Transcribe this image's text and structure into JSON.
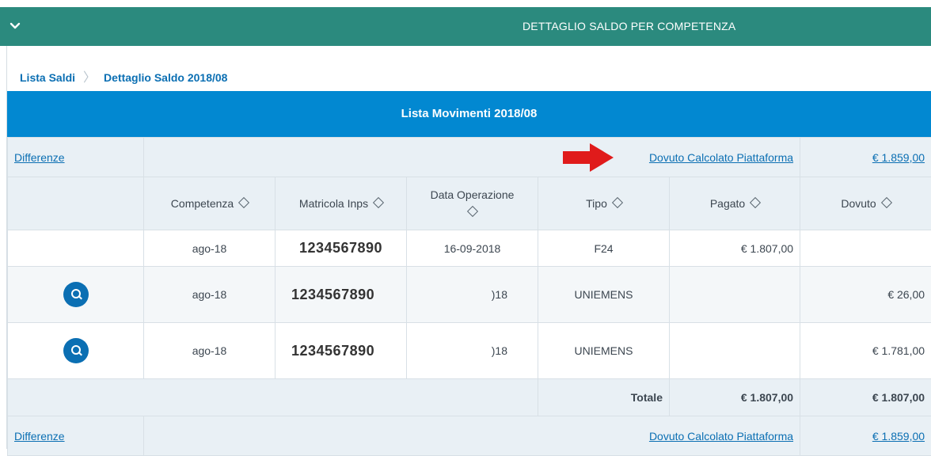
{
  "header": {
    "title": "DETTAGLIO SALDO PER COMPETENZA"
  },
  "breadcrumb": {
    "items": [
      "Lista Saldi",
      "Dettaglio Saldo 2018/08"
    ]
  },
  "section_title": "Lista Movimenti 2018/08",
  "diff_row": {
    "label": "Differenze",
    "platform_label": "Dovuto Calcolato Piattaforma",
    "platform_value": "€ 1.859,00"
  },
  "columns": [
    "Competenza",
    "Matricola Inps",
    "Data Operazione",
    "Tipo",
    "Pagato",
    "Dovuto"
  ],
  "rows": [
    {
      "competenza": "ago-18",
      "matricola": "1234567890",
      "data": "16-09-2018",
      "tipo": "F24",
      "pagato": "€ 1.807,00",
      "dovuto": ""
    },
    {
      "competenza": "ago-18",
      "matricola": "1234567890",
      "data": ")18",
      "tipo": "UNIEMENS",
      "pagato": "",
      "dovuto": "€ 26,00"
    },
    {
      "competenza": "ago-18",
      "matricola": "1234567890",
      "data": ")18",
      "tipo": "UNIEMENS",
      "pagato": "",
      "dovuto": "€ 1.781,00"
    }
  ],
  "total": {
    "label": "Totale",
    "pagato": "€ 1.807,00",
    "dovuto": "€ 1.807,00"
  },
  "colors": {
    "header": "#2b8a7e",
    "blue": "#0288d1",
    "link": "#0b6fb3",
    "arrow": "#e01b1b"
  },
  "icons": {
    "header": "chevron-down-icon",
    "row_action": "search-icon",
    "annotation": "red-arrow-icon"
  }
}
